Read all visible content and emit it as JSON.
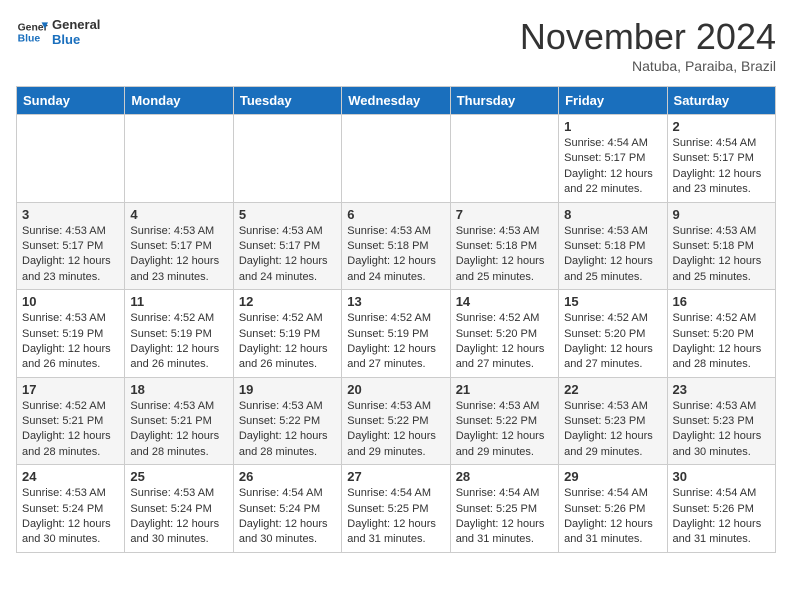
{
  "header": {
    "logo_general": "General",
    "logo_blue": "Blue",
    "month_title": "November 2024",
    "location": "Natuba, Paraiba, Brazil"
  },
  "calendar": {
    "days_of_week": [
      "Sunday",
      "Monday",
      "Tuesday",
      "Wednesday",
      "Thursday",
      "Friday",
      "Saturday"
    ],
    "weeks": [
      [
        {
          "day": "",
          "info": ""
        },
        {
          "day": "",
          "info": ""
        },
        {
          "day": "",
          "info": ""
        },
        {
          "day": "",
          "info": ""
        },
        {
          "day": "",
          "info": ""
        },
        {
          "day": "1",
          "info": "Sunrise: 4:54 AM\nSunset: 5:17 PM\nDaylight: 12 hours\nand 22 minutes."
        },
        {
          "day": "2",
          "info": "Sunrise: 4:54 AM\nSunset: 5:17 PM\nDaylight: 12 hours\nand 23 minutes."
        }
      ],
      [
        {
          "day": "3",
          "info": "Sunrise: 4:53 AM\nSunset: 5:17 PM\nDaylight: 12 hours\nand 23 minutes."
        },
        {
          "day": "4",
          "info": "Sunrise: 4:53 AM\nSunset: 5:17 PM\nDaylight: 12 hours\nand 23 minutes."
        },
        {
          "day": "5",
          "info": "Sunrise: 4:53 AM\nSunset: 5:17 PM\nDaylight: 12 hours\nand 24 minutes."
        },
        {
          "day": "6",
          "info": "Sunrise: 4:53 AM\nSunset: 5:18 PM\nDaylight: 12 hours\nand 24 minutes."
        },
        {
          "day": "7",
          "info": "Sunrise: 4:53 AM\nSunset: 5:18 PM\nDaylight: 12 hours\nand 25 minutes."
        },
        {
          "day": "8",
          "info": "Sunrise: 4:53 AM\nSunset: 5:18 PM\nDaylight: 12 hours\nand 25 minutes."
        },
        {
          "day": "9",
          "info": "Sunrise: 4:53 AM\nSunset: 5:18 PM\nDaylight: 12 hours\nand 25 minutes."
        }
      ],
      [
        {
          "day": "10",
          "info": "Sunrise: 4:53 AM\nSunset: 5:19 PM\nDaylight: 12 hours\nand 26 minutes."
        },
        {
          "day": "11",
          "info": "Sunrise: 4:52 AM\nSunset: 5:19 PM\nDaylight: 12 hours\nand 26 minutes."
        },
        {
          "day": "12",
          "info": "Sunrise: 4:52 AM\nSunset: 5:19 PM\nDaylight: 12 hours\nand 26 minutes."
        },
        {
          "day": "13",
          "info": "Sunrise: 4:52 AM\nSunset: 5:19 PM\nDaylight: 12 hours\nand 27 minutes."
        },
        {
          "day": "14",
          "info": "Sunrise: 4:52 AM\nSunset: 5:20 PM\nDaylight: 12 hours\nand 27 minutes."
        },
        {
          "day": "15",
          "info": "Sunrise: 4:52 AM\nSunset: 5:20 PM\nDaylight: 12 hours\nand 27 minutes."
        },
        {
          "day": "16",
          "info": "Sunrise: 4:52 AM\nSunset: 5:20 PM\nDaylight: 12 hours\nand 28 minutes."
        }
      ],
      [
        {
          "day": "17",
          "info": "Sunrise: 4:52 AM\nSunset: 5:21 PM\nDaylight: 12 hours\nand 28 minutes."
        },
        {
          "day": "18",
          "info": "Sunrise: 4:53 AM\nSunset: 5:21 PM\nDaylight: 12 hours\nand 28 minutes."
        },
        {
          "day": "19",
          "info": "Sunrise: 4:53 AM\nSunset: 5:22 PM\nDaylight: 12 hours\nand 28 minutes."
        },
        {
          "day": "20",
          "info": "Sunrise: 4:53 AM\nSunset: 5:22 PM\nDaylight: 12 hours\nand 29 minutes."
        },
        {
          "day": "21",
          "info": "Sunrise: 4:53 AM\nSunset: 5:22 PM\nDaylight: 12 hours\nand 29 minutes."
        },
        {
          "day": "22",
          "info": "Sunrise: 4:53 AM\nSunset: 5:23 PM\nDaylight: 12 hours\nand 29 minutes."
        },
        {
          "day": "23",
          "info": "Sunrise: 4:53 AM\nSunset: 5:23 PM\nDaylight: 12 hours\nand 30 minutes."
        }
      ],
      [
        {
          "day": "24",
          "info": "Sunrise: 4:53 AM\nSunset: 5:24 PM\nDaylight: 12 hours\nand 30 minutes."
        },
        {
          "day": "25",
          "info": "Sunrise: 4:53 AM\nSunset: 5:24 PM\nDaylight: 12 hours\nand 30 minutes."
        },
        {
          "day": "26",
          "info": "Sunrise: 4:54 AM\nSunset: 5:24 PM\nDaylight: 12 hours\nand 30 minutes."
        },
        {
          "day": "27",
          "info": "Sunrise: 4:54 AM\nSunset: 5:25 PM\nDaylight: 12 hours\nand 31 minutes."
        },
        {
          "day": "28",
          "info": "Sunrise: 4:54 AM\nSunset: 5:25 PM\nDaylight: 12 hours\nand 31 minutes."
        },
        {
          "day": "29",
          "info": "Sunrise: 4:54 AM\nSunset: 5:26 PM\nDaylight: 12 hours\nand 31 minutes."
        },
        {
          "day": "30",
          "info": "Sunrise: 4:54 AM\nSunset: 5:26 PM\nDaylight: 12 hours\nand 31 minutes."
        }
      ]
    ]
  }
}
